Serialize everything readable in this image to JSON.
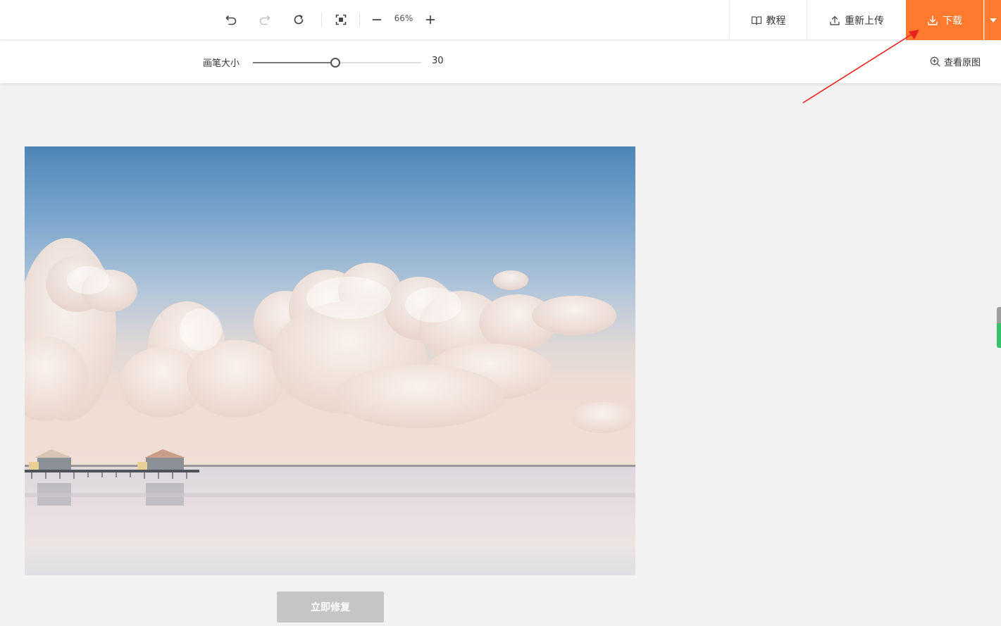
{
  "toolbar": {
    "zoom_label": "66%",
    "tools": [
      {
        "icon": "undo-icon"
      },
      {
        "icon": "redo-icon"
      },
      {
        "icon": "reset-icon"
      },
      {
        "icon": "fit-screen-icon"
      },
      {
        "icon": "zoom-out-icon"
      },
      {
        "icon": "zoom-in-icon"
      }
    ]
  },
  "nav": {
    "tutorial_label": "教程",
    "reupload_label": "重新上传",
    "download_label": "下载"
  },
  "brush": {
    "label": "画笔大小",
    "value": "30",
    "min": 1,
    "max": 60
  },
  "view_original_label": "查看原图",
  "action": {
    "fix_label": "立即修复"
  },
  "colors": {
    "accent": "#ff7a2e",
    "annotation_arrow": "#e8231f",
    "disabled_button": "#c5c5c5"
  }
}
